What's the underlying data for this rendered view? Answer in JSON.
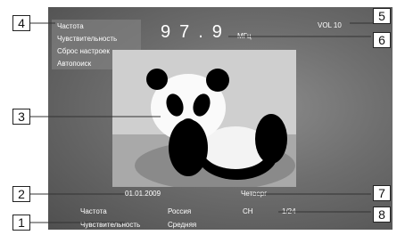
{
  "menu": {
    "items": [
      "Частота",
      "Чувствительность",
      "Сброс настроек",
      "Автопоиск"
    ]
  },
  "display": {
    "frequency": "97.9",
    "unit": "МГц",
    "volume": "VOL 10"
  },
  "photo": {
    "icon": "panda-photo"
  },
  "status": {
    "date": "01.01.2009",
    "weekday": "Четверг",
    "rows": [
      {
        "label": "Частота",
        "value": "Россия",
        "extra_label": "CH",
        "extra_value": "1/24"
      },
      {
        "label": "Чувствительность",
        "value": "Средняя"
      }
    ]
  },
  "callouts": [
    "1",
    "2",
    "3",
    "4",
    "5",
    "6",
    "7",
    "8"
  ]
}
